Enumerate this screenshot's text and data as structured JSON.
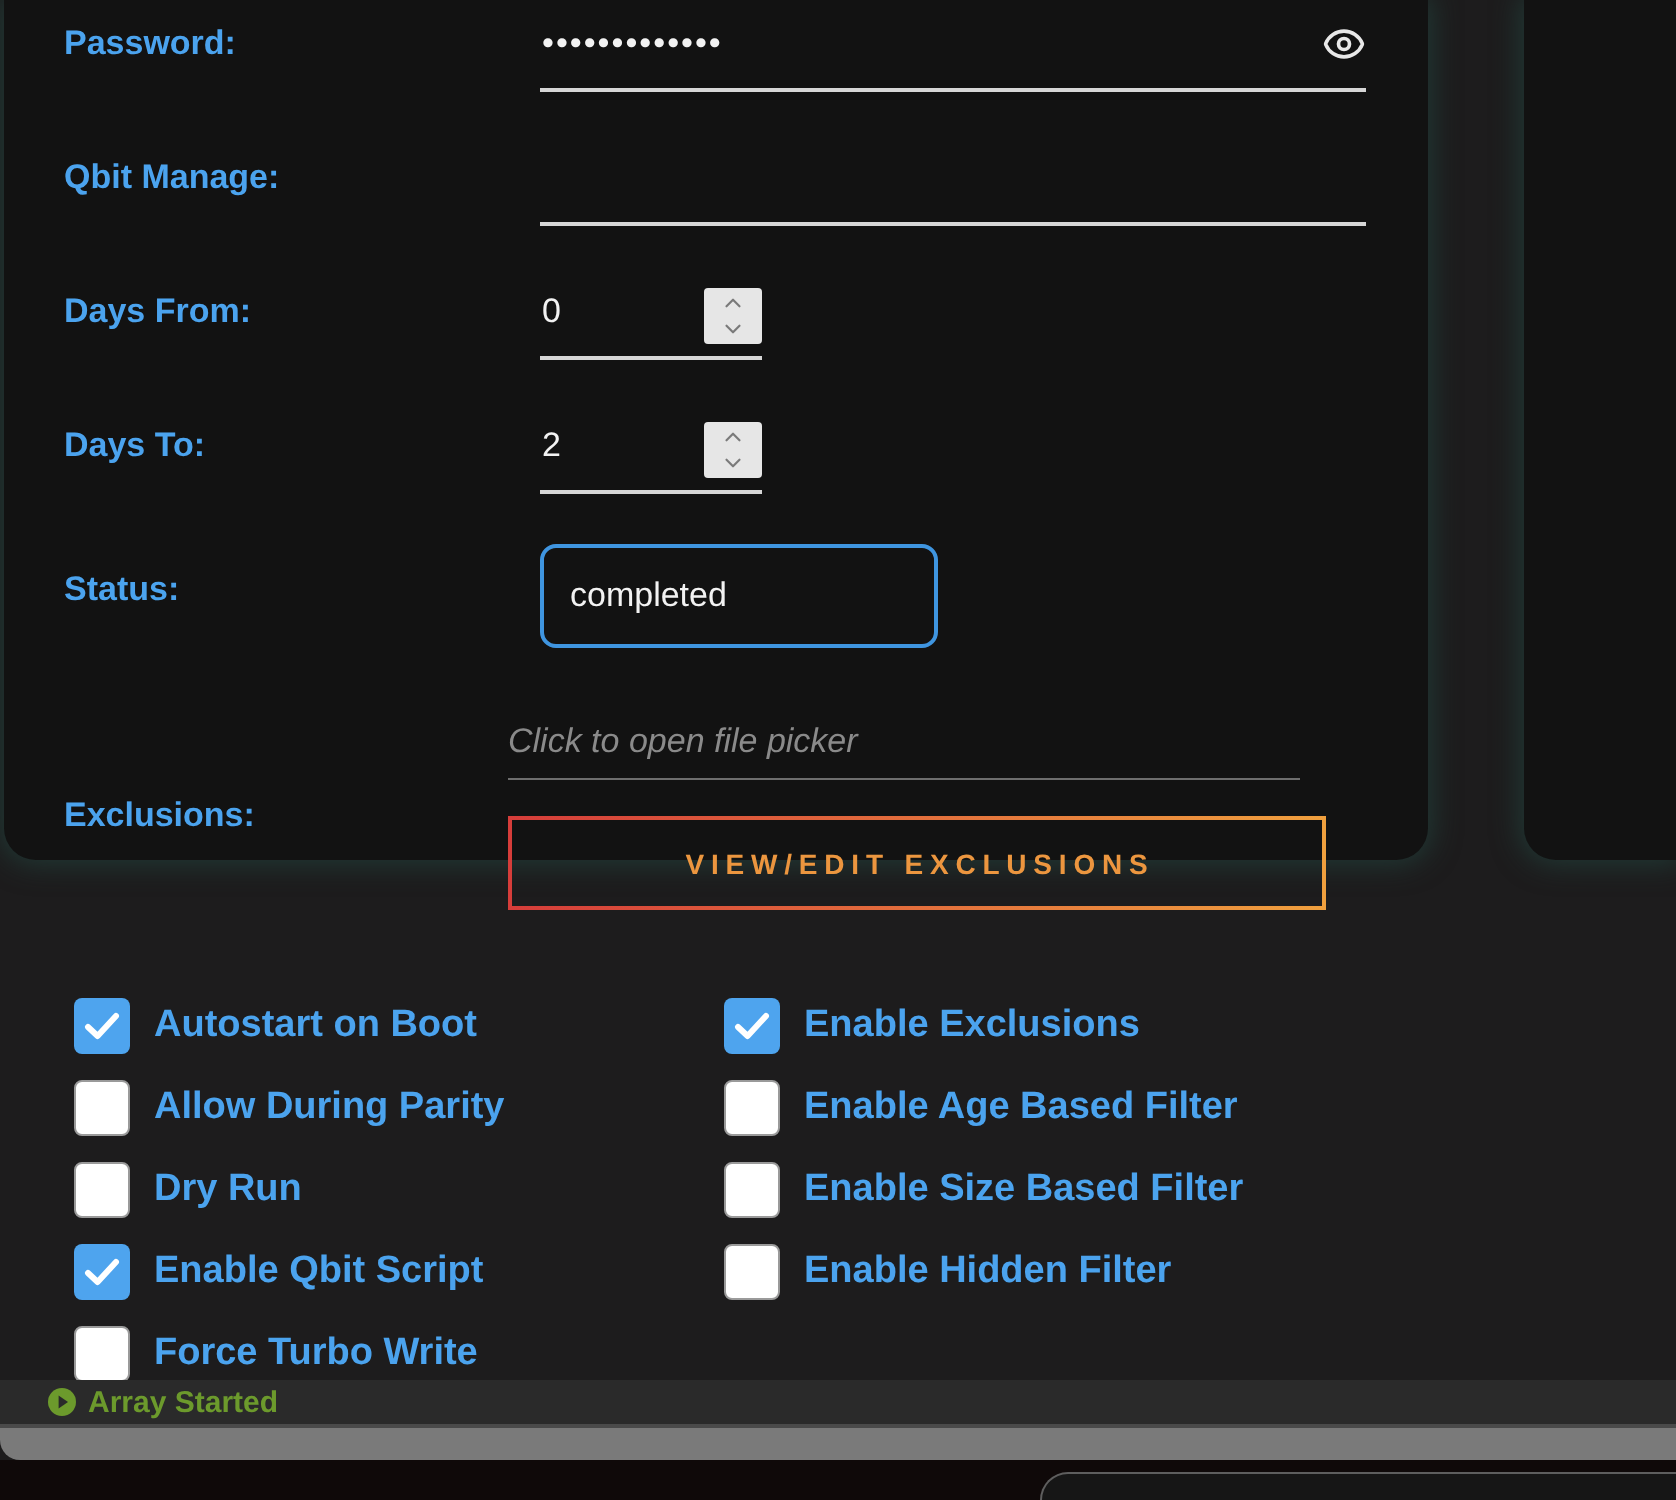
{
  "form": {
    "fields": [
      {
        "kind": "password",
        "label": "Password:",
        "value": "•••••••••••••"
      },
      {
        "kind": "text",
        "label": "Qbit Manage:"
      },
      {
        "kind": "number",
        "label": "Days From:",
        "value": "0"
      },
      {
        "kind": "number",
        "label": "Days To:",
        "value": "2"
      },
      {
        "kind": "outlined",
        "label": "Status:",
        "value": "completed"
      },
      {
        "kind": "file",
        "label": "Exclusions:",
        "placeholder": "Click to open file picker",
        "button": "VIEW/EDIT EXCLUSIONS"
      }
    ]
  },
  "options": {
    "columns": [
      {
        "items": [
          {
            "label": "Autostart on Boot",
            "checked": true
          },
          {
            "label": "Allow During Parity",
            "checked": false
          },
          {
            "label": "Dry Run",
            "checked": false
          },
          {
            "label": "Enable Qbit Script",
            "checked": true
          },
          {
            "label": "Force Turbo Write",
            "checked": false
          }
        ]
      },
      {
        "items": [
          {
            "label": "Enable Exclusions",
            "checked": true
          },
          {
            "label": "Enable Age Based Filter",
            "checked": false
          },
          {
            "label": "Enable Size Based Filter",
            "checked": false
          },
          {
            "label": "Enable Hidden Filter",
            "checked": false
          }
        ]
      }
    ]
  },
  "status_bar": {
    "text": "Array Started"
  }
}
